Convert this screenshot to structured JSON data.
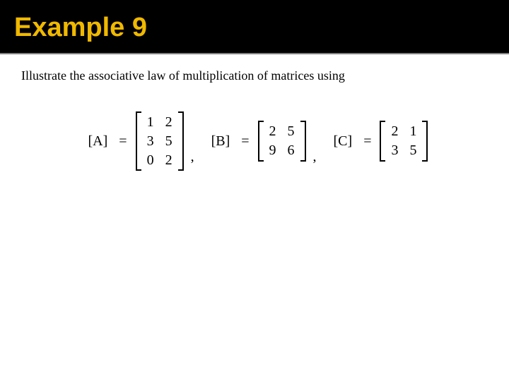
{
  "header": {
    "title": "Example 9"
  },
  "prompt": "Illustrate the associative law of multiplication of matrices using",
  "labels": {
    "A": "[A]",
    "B": "[B]",
    "C": "[C]",
    "eq": "=",
    "comma": ","
  },
  "matrices": {
    "A": {
      "rows": 3,
      "cols": 2,
      "v": [
        "1",
        "2",
        "3",
        "5",
        "0",
        "2"
      ]
    },
    "B": {
      "rows": 2,
      "cols": 2,
      "v": [
        "2",
        "5",
        "9",
        "6"
      ]
    },
    "C": {
      "rows": 2,
      "cols": 2,
      "v": [
        "2",
        "1",
        "3",
        "5"
      ]
    }
  }
}
